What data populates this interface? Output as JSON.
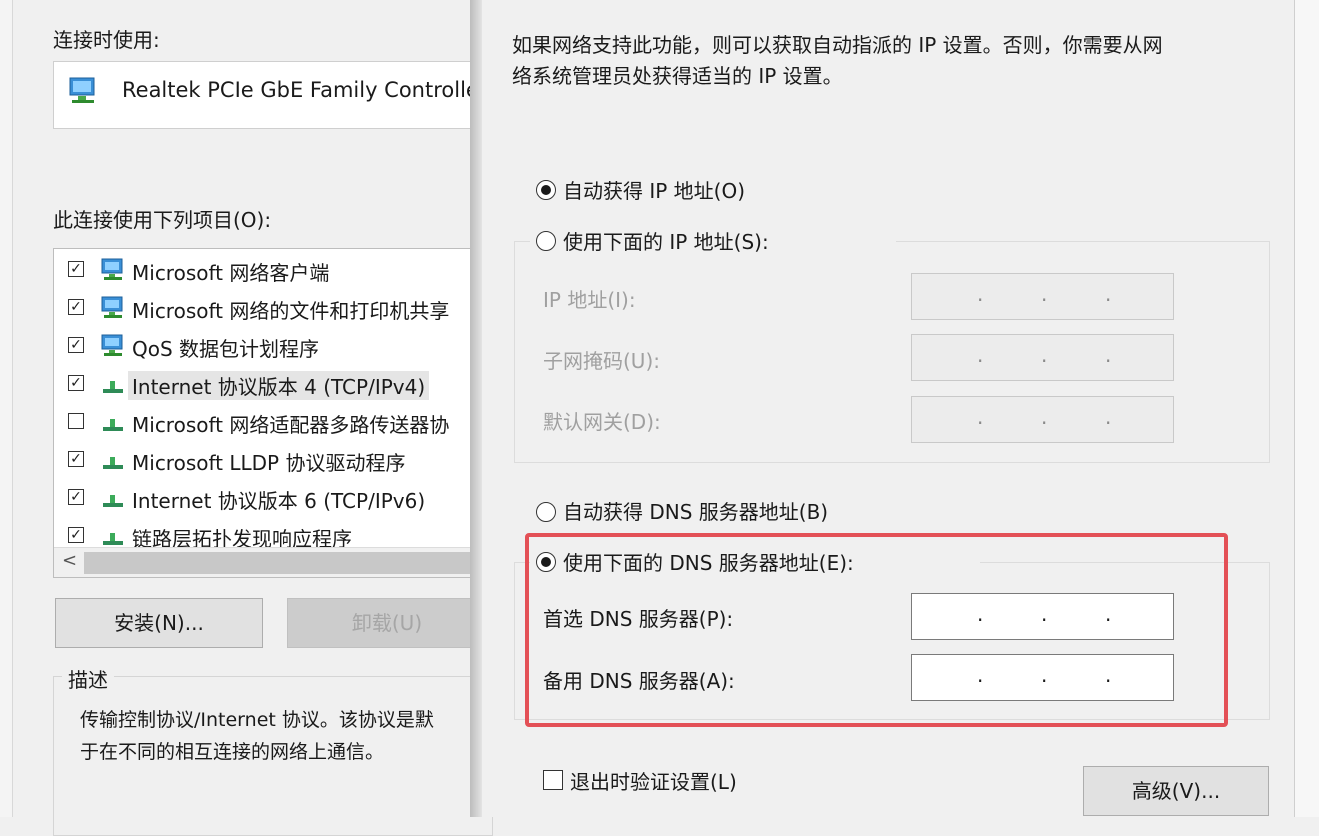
{
  "left": {
    "connect_using_label": "连接时使用:",
    "adapter_name": "Realtek PCIe GbE Family Controlle",
    "items_label": "此连接使用下列项目(O):",
    "items": [
      {
        "label": "Microsoft 网络客户端",
        "checked": true,
        "icon": "network-client-icon"
      },
      {
        "label": "Microsoft 网络的文件和打印机共享",
        "checked": true,
        "icon": "network-client-icon"
      },
      {
        "label": "QoS 数据包计划程序",
        "checked": true,
        "icon": "network-client-icon"
      },
      {
        "label": "Internet 协议版本 4 (TCP/IPv4)",
        "checked": true,
        "icon": "protocol-icon",
        "selected": true
      },
      {
        "label": "Microsoft 网络适配器多路传送器协",
        "checked": false,
        "icon": "protocol-icon"
      },
      {
        "label": "Microsoft LLDP 协议驱动程序",
        "checked": true,
        "icon": "protocol-icon"
      },
      {
        "label": "Internet 协议版本 6 (TCP/IPv6)",
        "checked": true,
        "icon": "protocol-icon"
      },
      {
        "label": "链路层拓扑发现响应程序",
        "checked": true,
        "icon": "protocol-icon"
      }
    ],
    "scroll_left": "<",
    "install_button": "安装(N)...",
    "uninstall_button": "卸载(U)",
    "description_legend": "描述",
    "description_line1": "传输控制协议/Internet 协议。该协议是默",
    "description_line2": "于在不同的相互连接的网络上通信。"
  },
  "right": {
    "intro_line1": "如果网络支持此功能，则可以获取自动指派的 IP 设置。否则，你需要从网",
    "intro_line2": "络系统管理员处获得适当的 IP 设置。",
    "auto_ip": "自动获得 IP 地址(O)",
    "manual_ip": "使用下面的 IP 地址(S):",
    "ip_address_label": "IP 地址(I):",
    "subnet_label": "子网掩码(U):",
    "gateway_label": "默认网关(D):",
    "ip_dot": ".",
    "auto_dns": "自动获得 DNS 服务器地址(B)",
    "manual_dns": "使用下面的 DNS 服务器地址(E):",
    "preferred_dns_label": "首选 DNS 服务器(P):",
    "alternate_dns_label": "备用 DNS 服务器(A):",
    "validate_label": "退出时验证设置(L)",
    "advanced_button": "高级(V)..."
  },
  "colors": {
    "highlight": "#e35056",
    "dialog_bg": "#f0f0f0"
  }
}
